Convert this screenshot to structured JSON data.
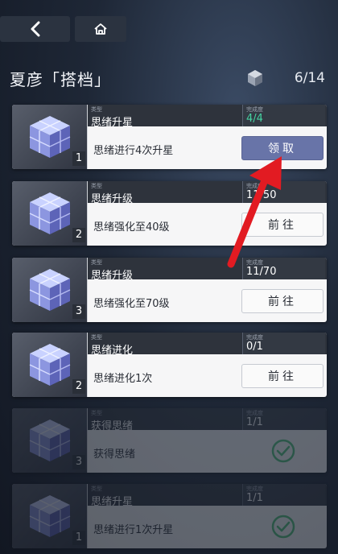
{
  "nav": {
    "back_icon": "chevron-left-icon",
    "home_icon": "home-icon"
  },
  "header": {
    "title": "夏彦「搭档」",
    "count": "6/14"
  },
  "labels": {
    "type": "类型",
    "progress": "完成度"
  },
  "tasks": [
    {
      "name": "思绪升星",
      "progress": "4/4",
      "desc": "思绪进行4次升星",
      "level": "1",
      "action": "领取",
      "state": "claimable"
    },
    {
      "name": "思绪升级",
      "progress": "11/50",
      "desc": "思绪强化至40级",
      "level": "2",
      "action": "前往",
      "state": "in-progress"
    },
    {
      "name": "思绪升级",
      "progress": "11/70",
      "desc": "思绪强化至70级",
      "level": "3",
      "action": "前往",
      "state": "in-progress"
    },
    {
      "name": "思绪进化",
      "progress": "0/1",
      "desc": "思绪进化1次",
      "level": "2",
      "action": "前往",
      "state": "in-progress"
    },
    {
      "name": "获得思绪",
      "progress": "1/1",
      "desc": "获得思绪",
      "level": "3",
      "action": "",
      "state": "completed"
    },
    {
      "name": "思绪升星",
      "progress": "1/1",
      "desc": "思绪进行1次升星",
      "level": "1",
      "action": "",
      "state": "completed"
    }
  ],
  "colors": {
    "claim_button": "#6874a8",
    "done_progress": "#45d4a2",
    "arrow": "#e21b22"
  }
}
